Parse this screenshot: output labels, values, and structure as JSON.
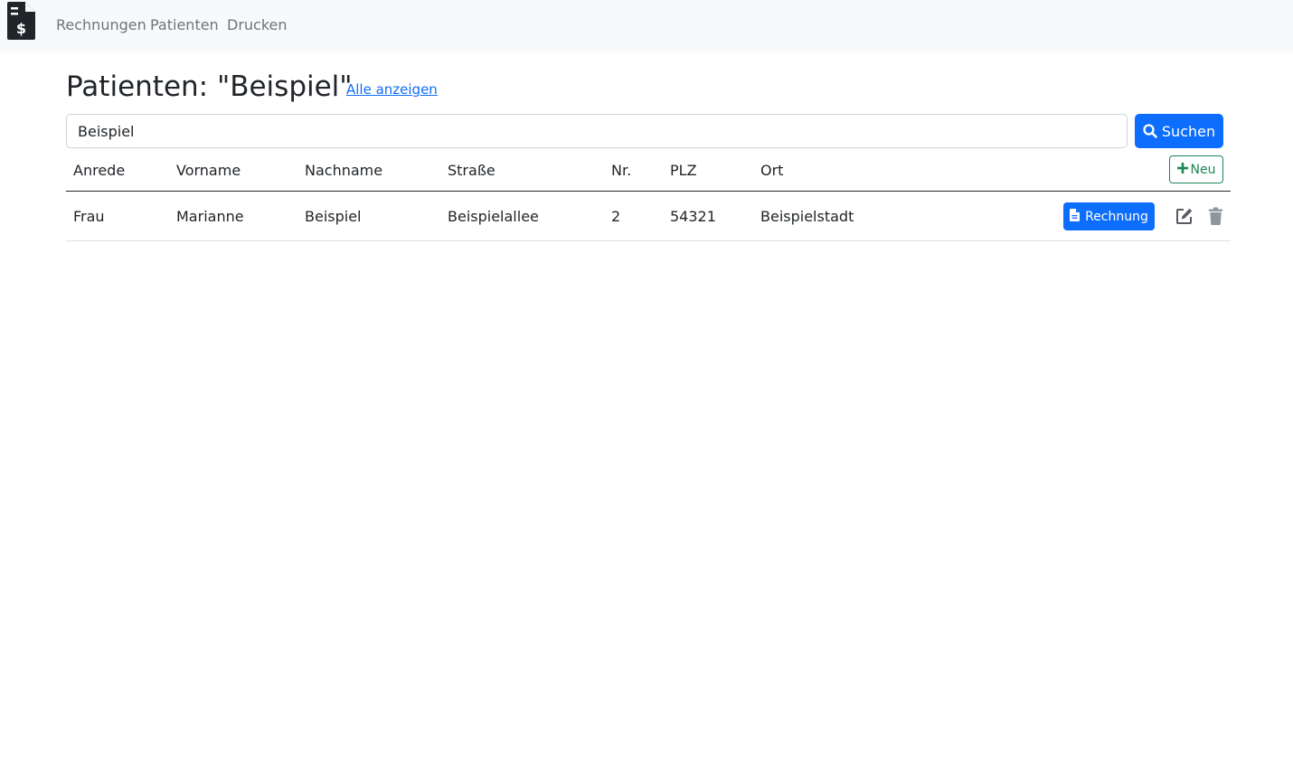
{
  "nav": {
    "logo_icon": "invoice-dollar-icon",
    "items": [
      {
        "label": "Rechnungen"
      },
      {
        "label": "Patienten"
      },
      {
        "label": "Drucken"
      }
    ]
  },
  "page": {
    "title": "Patienten: \"Beispiel\"",
    "show_all_label": "Alle anzeigen"
  },
  "search": {
    "value": "Beispiel",
    "button_label": "Suchen",
    "button_icon": "search-icon"
  },
  "table": {
    "columns": [
      "Anrede",
      "Vorname",
      "Nachname",
      "Straße",
      "Nr.",
      "PLZ",
      "Ort"
    ],
    "new_button_label": "Neu",
    "rows": [
      {
        "cells": [
          "Frau",
          "Marianne",
          "Beispiel",
          "Beispielallee",
          "2",
          "54321",
          "Beispielstadt"
        ],
        "invoice_button_label": "Rechnung"
      }
    ]
  },
  "colors": {
    "primary": "#0d6efd",
    "success": "#198754",
    "navbar_bg": "#f8f9fa",
    "nav_text": "#6c757d"
  }
}
